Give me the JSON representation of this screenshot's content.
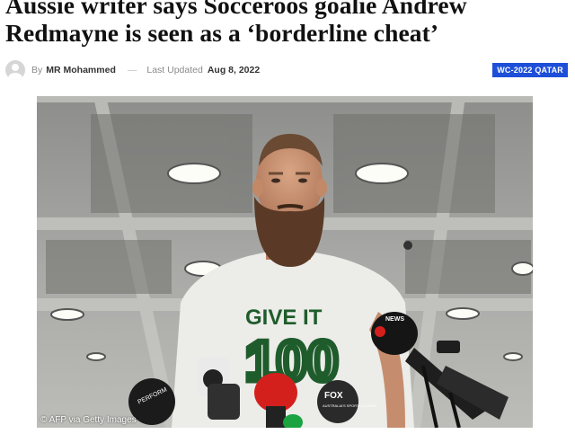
{
  "article": {
    "headline": "Aussie writer says Socceroos goalie Andrew Redmayne is seen as a ‘borderline cheat’",
    "by_label": "By",
    "author": "MR Mohammed",
    "separator": "—",
    "updated_label": "Last Updated",
    "date": "Aug 8, 2022",
    "category_badge": "WC-2022 QATAR"
  },
  "image": {
    "credit": "© AFP via Getty Images",
    "shirt_line1": "GIVE IT",
    "shirt_line2": "100",
    "mic_label_left": "PERFORM",
    "mic_label_news": "NEWS",
    "mic_label_fox": "FOX",
    "mic_label_fox_sub": "AUSTRALIA'S SPORTS LEADER"
  },
  "colors": {
    "badge_bg": "#1d4fd8",
    "shirt_text": "#1f5c2c",
    "mic_red": "#d4201d"
  }
}
